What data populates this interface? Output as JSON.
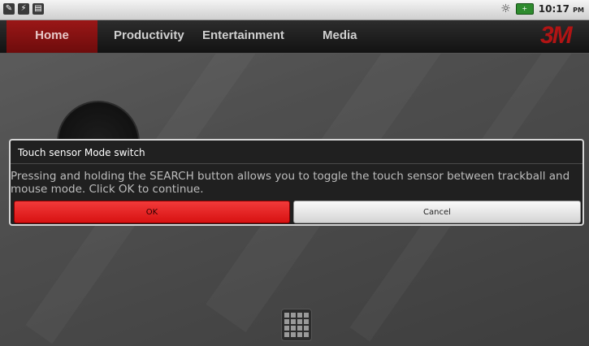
{
  "status_bar": {
    "time": "10:17",
    "ampm": "PM",
    "left_icons": [
      "usb-debug-icon",
      "usb-icon",
      "sd-card-icon"
    ],
    "right_icons": [
      "brightness-icon",
      "battery-icon"
    ]
  },
  "tabs": [
    {
      "label": "Home",
      "active": true
    },
    {
      "label": "Productivity",
      "active": false
    },
    {
      "label": "Entertainment",
      "active": false
    },
    {
      "label": "Media",
      "active": false
    }
  ],
  "brand_logo": "3M",
  "dialog": {
    "title": "Touch sensor Mode switch",
    "message": "Pressing and holding the SEARCH button allows you to toggle the touch sensor between trackball and mouse mode. Click OK to continue.",
    "ok_label": "OK",
    "cancel_label": "Cancel"
  },
  "colors": {
    "accent_red": "#d81212",
    "tab_active": "#8a1313",
    "dialog_bg": "#202020"
  }
}
